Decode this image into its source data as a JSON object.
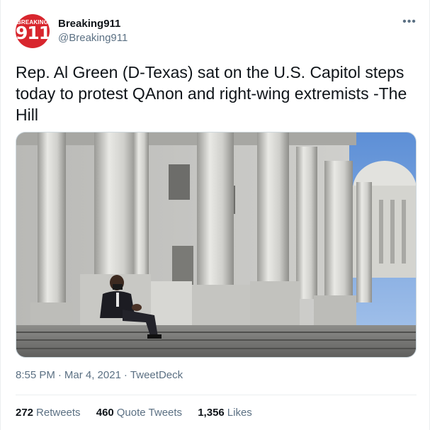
{
  "author": {
    "name": "Breaking911",
    "handle": "@Breaking911",
    "avatar_text_top": "BREAKING",
    "avatar_text_main": "911",
    "avatar_color": "#d8262e"
  },
  "menu": {
    "more_icon": "more-horizontal-icon",
    "more_label": "•••"
  },
  "tweet": {
    "text": "Rep. Al Green (D-Texas) sat on the U.S. Capitol steps today to protest QAnon and right-wing extremists -The Hill"
  },
  "media": {
    "description_icon": "photo-capitol-steps"
  },
  "meta": {
    "time": "8:55 PM",
    "separator": "·",
    "date": "Mar 4, 2021",
    "source": "TweetDeck"
  },
  "stats": {
    "retweets_count": "272",
    "retweets_label": "Retweets",
    "quotes_count": "460",
    "quotes_label": "Quote Tweets",
    "likes_count": "1,356",
    "likes_label": "Likes"
  },
  "colors": {
    "text_primary": "#0f1419",
    "text_secondary": "#5b7083",
    "divider": "#ebeef0"
  }
}
